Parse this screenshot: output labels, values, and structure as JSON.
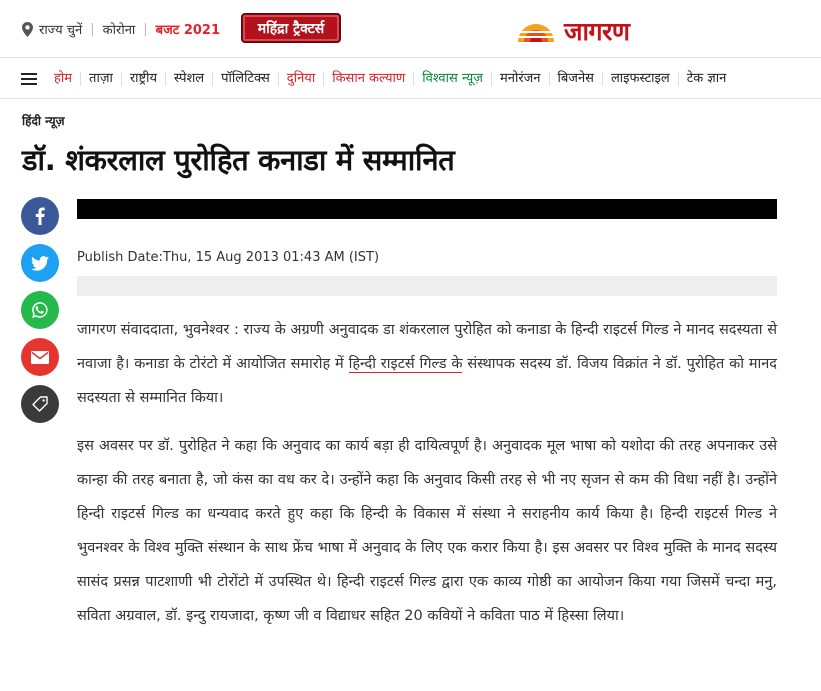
{
  "topbar": {
    "location_label": "राज्य चुनें",
    "corona_label": "कोरोना",
    "budget_label": "बजट 2021",
    "promo_label": "महिंद्रा ट्रैक्टर्स"
  },
  "logo": {
    "text": "जागरण"
  },
  "nav": {
    "items": [
      {
        "label": "होम",
        "color": "#d8232a"
      },
      {
        "label": "ताज़ा"
      },
      {
        "label": "राष्ट्रीय"
      },
      {
        "label": "स्पेशल"
      },
      {
        "label": "पॉलिटिक्स"
      },
      {
        "label": "दुनिया",
        "color": "#d8232a"
      },
      {
        "label": "किसान कल्याण",
        "color": "#d8232a"
      },
      {
        "label": "विश्वास न्यूज़",
        "color": "#0a8a3a"
      },
      {
        "label": "मनोरंजन"
      },
      {
        "label": "बिजनेस"
      },
      {
        "label": "लाइफस्टाइल"
      },
      {
        "label": "टेक ज्ञान"
      }
    ]
  },
  "article": {
    "breadcrumb": "हिंदी न्यूज़",
    "title": "डॉ. शंकरलाल पुरोहित कनाडा में सम्मानित",
    "publish_date": "Publish Date:Thu, 15 Aug 2013 01:43 AM (IST)",
    "para1_a": "जागरण संवाददाता, भुवनेश्वर : राज्य के अग्रणी अनुवादक डा शंकरलाल पुरोहित को कनाडा के हिन्दी राइटर्स गिल्ड ने मानद सदस्यता से नवाजा है। कनाडा के टोरंटो में आयोजित समारोह में ",
    "para1_link": "हिन्दी राइटर्स गिल्ड के",
    "para1_b": " संस्थापक सदस्य डॉ. विजय विक्रांत ने डॉ. पुरोहित को मानद सदस्यता से सम्मानित किया।",
    "para2": "इस अवसर पर डॉ. पुरोहित ने कहा कि अनुवाद का कार्य बड़ा ही दायित्वपूर्ण है। अनुवादक मूल भाषा को यशोदा की तरह अपनाकर उसे कान्हा की तरह बनाता है, जो कंस का वध कर दे। उन्होंने कहा कि अनुवाद किसी तरह से भी नए सृजन से कम की विधा नहीं है। उन्होंने हिन्दी राइटर्स गिल्ड का धन्यवाद करते हुए कहा कि हिन्दी के विकास में संस्था ने सराहनीय कार्य किया है। हिन्दी राइटर्स गिल्ड ने भुवनश्वर के विश्व मुक्ति संस्थान के साथ फ्रेंच भाषा में अनुवाद के लिए एक करार किया है। इस अवसर पर विश्व मुक्ति के मानद सदस्य सासंद प्रसन्न पाटशाणी भी टोरोंटो में उपस्थित थे। हिन्दी राइटर्स गिल्ड द्वारा एक काव्य गोष्ठी का आयोजन किया गया जिसमें चन्दा मनु, सविता अग्रवाल, डॉ. इन्दु रायजादा, कृष्ण जी व विद्याधर सहित 20 कवियों ने कविता पाठ में हिस्सा लिया।"
  },
  "share_icons": [
    "facebook-icon",
    "twitter-icon",
    "whatsapp-icon",
    "email-icon",
    "tag-icon"
  ],
  "colors": {
    "brand_red": "#d8232a",
    "green": "#0a8a3a",
    "facebook": "#3b5998",
    "twitter": "#1da1f2",
    "whatsapp": "#25b94b",
    "email": "#e4362f"
  }
}
